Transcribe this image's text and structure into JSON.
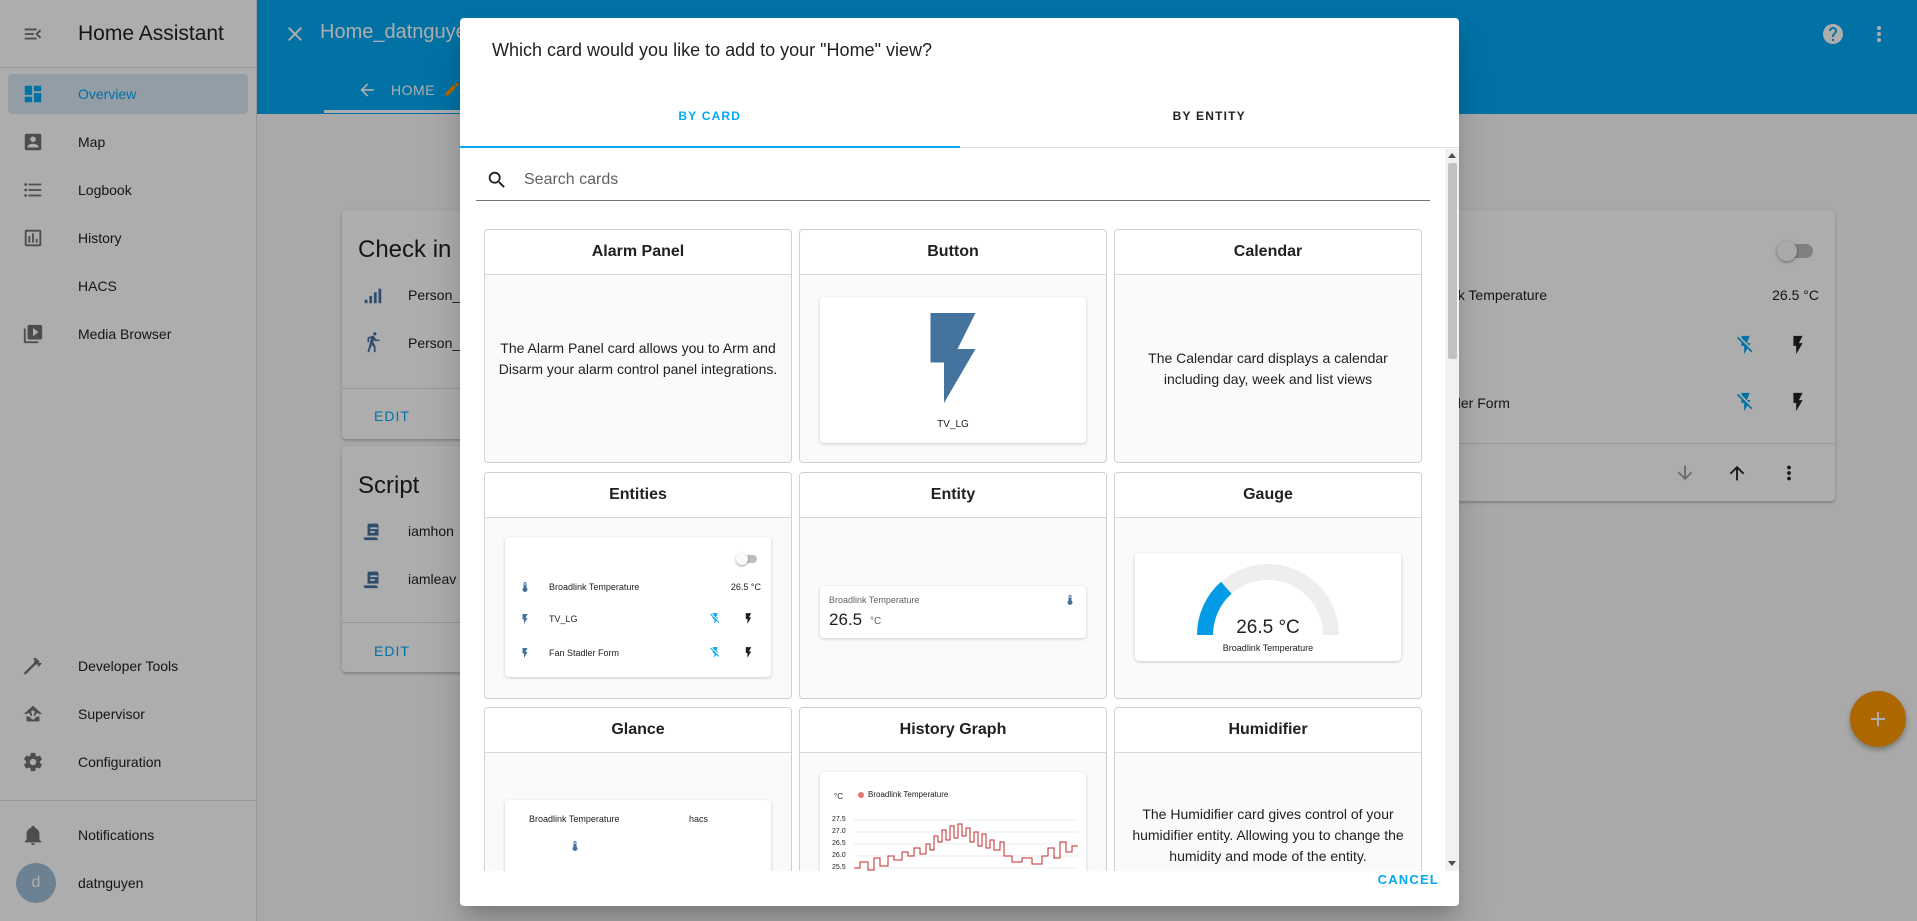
{
  "sidebar": {
    "title": "Home Assistant",
    "items": [
      {
        "label": "Overview",
        "icon": "view-dashboard-icon"
      },
      {
        "label": "Map",
        "icon": "account-box-icon"
      },
      {
        "label": "Logbook",
        "icon": "format-list-bulleted-icon"
      },
      {
        "label": "History",
        "icon": "chart-box-icon"
      },
      {
        "label": "HACS",
        "icon": ""
      },
      {
        "label": "Media Browser",
        "icon": "play-box-multiple-icon"
      }
    ],
    "bottom_items": [
      {
        "label": "Developer Tools",
        "icon": "hammer-icon"
      },
      {
        "label": "Supervisor",
        "icon": "home-assistant-icon"
      },
      {
        "label": "Configuration",
        "icon": "cog-icon"
      }
    ],
    "notifications_label": "Notifications",
    "user": {
      "initial": "d",
      "name": "datnguyen"
    }
  },
  "topbar": {
    "title": "Home_datnguyen",
    "view_tab": "HOME",
    "accent": "#03a9f4"
  },
  "background_cards": {
    "check_in": {
      "title": "Check in",
      "rows": [
        "Person_",
        "Person_"
      ],
      "edit": "EDIT"
    },
    "script": {
      "title": "Script",
      "rows": [
        "iamhon",
        "iamleav"
      ],
      "edit": "EDIT"
    },
    "entities": {
      "rows": [
        {
          "label": "nk Temperature",
          "value": "26.5 °C"
        },
        {
          "label": "",
          "value": ""
        },
        {
          "label": "dler Form",
          "value": ""
        }
      ]
    }
  },
  "dialog": {
    "title": "Which card would you like to add to your \"Home\" view?",
    "tabs": [
      "BY CARD",
      "BY ENTITY"
    ],
    "search_placeholder": "Search cards",
    "cancel": "CANCEL",
    "cards": {
      "alarm_panel": {
        "title": "Alarm Panel",
        "description": "The Alarm Panel card allows you to Arm and Disarm your alarm control panel integrations."
      },
      "button": {
        "title": "Button",
        "entity": "TV_LG"
      },
      "calendar": {
        "title": "Calendar",
        "description": "The Calendar card displays a calendar including day, week and list views"
      },
      "entities": {
        "title": "Entities",
        "rows": [
          {
            "name": "Broadlink Temperature",
            "value": "26.5 °C"
          },
          {
            "name": "TV_LG",
            "value": ""
          },
          {
            "name": "Fan Stadler Form",
            "value": ""
          }
        ]
      },
      "entity": {
        "title": "Entity",
        "name": "Broadlink Temperature",
        "value": "26.5",
        "unit": "°C"
      },
      "gauge": {
        "title": "Gauge",
        "value": "26.5 °C",
        "name": "Broadlink Temperature",
        "fill_fraction": 0.27
      },
      "glance": {
        "title": "Glance",
        "items": [
          "Broadlink Temperature",
          "hacs"
        ]
      },
      "history_graph": {
        "title": "History Graph",
        "unit": "°C",
        "legend": "Broadlink Temperature",
        "y_ticks": [
          "27.5",
          "27.0",
          "26.5",
          "26.0",
          "25.5"
        ]
      },
      "humidifier": {
        "title": "Humidifier",
        "description": "The Humidifier card gives control of your humidifier entity. Allowing you to change the humidity and mode of the entity."
      }
    }
  }
}
